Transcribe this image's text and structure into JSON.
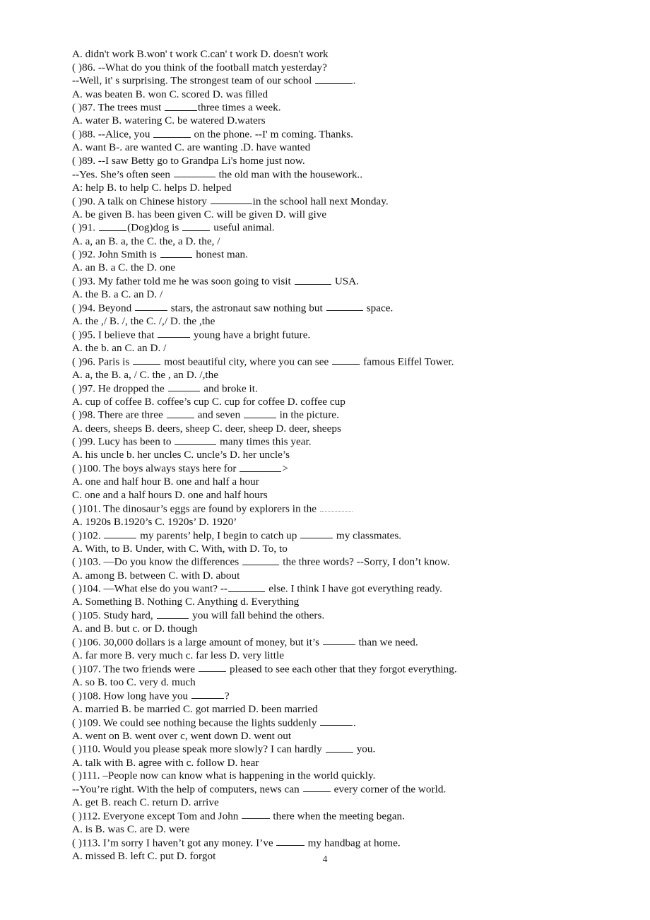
{
  "document": {
    "page_number": "4",
    "lines": [
      "A. didn't work B.won' t work C.can' t work D. doesn't work",
      "( )86. --What do you think of the football match yesterday?",
      "--Well, it' s surprising. The strongest team of our school ________.",
      "A. was beaten B. won C. scored D. was filled",
      "( )87. The trees must _______three times a week.",
      "A. water B. watering C. be watered D.waters",
      "( )88. --Alice, you ________ on the phone. --I' m coming. Thanks.",
      "A. want B-. are wanted C. are wanting .D. have wanted",
      "( )89. --I saw Betty go to Grandpa Li's home just now.",
      "--Yes. She’s often seen _________ the old man with the housework..",
      "A: help B. to help C. helps D. helped",
      "( )90. A talk on Chinese history _________in the school hall next Monday.",
      "A. be given B. has been given C. will be given D. will give",
      "( )91. ______(Dog)dog is ______ useful animal.",
      "A. a, an B. a, the C. the, a D. the, /",
      "( )92. John Smith is _______ honest man.",
      "A. an B. a C. the D. one",
      "( )93. My father told me he was soon going to visit ________ USA.",
      "A. the B. a C. an D. /",
      "( )94. Beyond _______ stars, the astronaut saw nothing but ________ space.",
      "A. the ,/ B. /, the C. /,/ D. the ,the",
      "( )95. I believe that _______ young have a bright future.",
      "A. the b. an C. an D. /",
      "( )96. Paris is ______ most beautiful city, where you can see ______ famous Eiffel Tower.",
      "A. a, the B. a, / C. the , an D. /,the",
      "( )97. He dropped the _______ and broke it.",
      "A. cup of coffee B. coffee’s cup C. cup for coffee D. coffee cup",
      "( )98. There are three ______ and seven _______ in the picture.",
      "A. deers, sheeps B. deers, sheep C. deer, sheep D. deer, sheeps",
      "( )99. Lucy has been to _________ many times this year.",
      "A. his uncle b. her uncles C. uncle’s D. her uncle’s",
      "( )100. The boys always stays here for _________>",
      "A. one and half hour B. one and half a hour",
      "C. one and a half hours D. one and half hours",
      "( )101. The dinosaur’s eggs are found by explorers in the _______",
      "A. 1920s B.1920’s C. 1920s’ D. 1920’",
      "( )102. _______ my parents’ help, I begin to catch up _______ my classmates.",
      "A. With, to B. Under, with C. With, with D. To, to",
      "( )103. —Do you know the differences ________ the three words? --Sorry, I don’t know.",
      "A. among B. between C. with D. about",
      "( )104. —What else do you want? --________ else. I think I have got everything ready.",
      "A. Something B. Nothing C. Anything d. Everything",
      "( )105. Study hard, _______ you will fall behind the others.",
      "A. and B. but c. or D. though",
      "( )106. 30,000 dollars is a large amount of money, but it’s _______ than we need.",
      "A. far more B. very much c. far less D. very little",
      "( )107. The two friends were ______ pleased to see each other that they forgot everything.",
      "A. so B. too C. very d. much",
      "( )108. How long have you _______?",
      "A. married B. be married C. got married D. been married",
      "( )109. We could see nothing because the lights suddenly _______.",
      "A. went on B. went over c, went down D. went out",
      "( )110. Would you please speak more slowly? I can hardly ______ you.",
      "A. talk with B. agree with c. follow D. hear",
      "( )111. –People now can know what is happening in the world quickly.",
      "--You’re right. With the help of computers, news can ______ every corner of the world.",
      "A. get B. reach C. return D. arrive",
      "( )112. Everyone except Tom and John ______ there when the meeting began.",
      "A. is B. was C. are D. were",
      "( )113. I’m sorry I haven’t got any money. I’ve ______ my handbag at home.",
      "A. missed B. left C. put D. forgot"
    ]
  }
}
